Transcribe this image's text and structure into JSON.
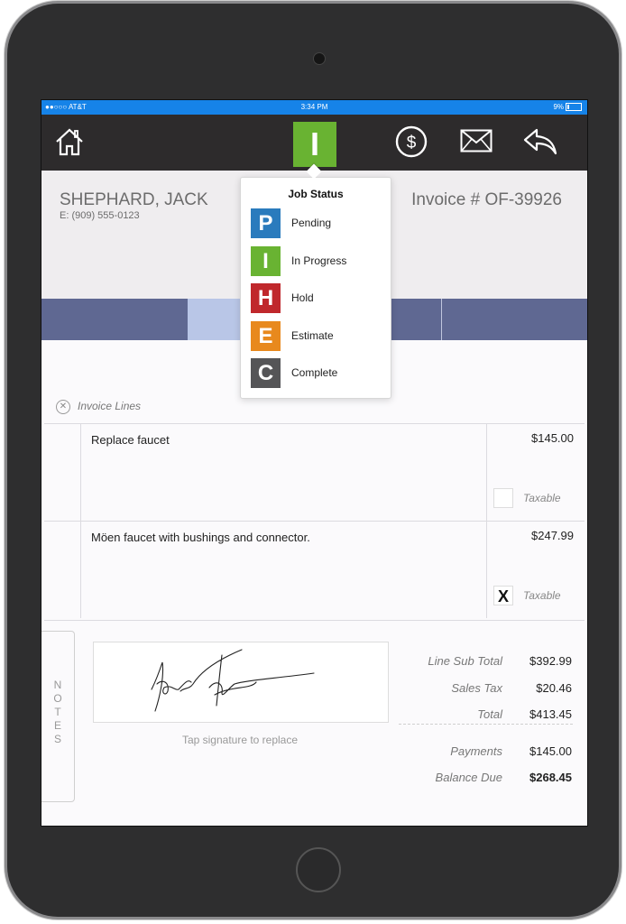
{
  "statusbar": {
    "carrier": "●●○○○ AT&T",
    "time": "3:34 PM",
    "battery": "9%"
  },
  "toolbar": {
    "home_icon": "home-icon",
    "job_status_letter": "I",
    "job_status_color": "#69b332",
    "payment_icon": "dollar-circle-icon",
    "email_icon": "envelope-icon",
    "back_icon": "reply-arrow-icon"
  },
  "customer": {
    "name": "SHEPHARD, JACK",
    "phone": "E: (909) 555-0123"
  },
  "invoice": {
    "number": "Invoice # OF-39926"
  },
  "job_status_menu": {
    "title": "Job Status",
    "items": [
      {
        "letter": "P",
        "label": "Pending",
        "color": "#2a7bbd"
      },
      {
        "letter": "I",
        "label": "In Progress",
        "color": "#69b332"
      },
      {
        "letter": "H",
        "label": "Hold",
        "color": "#c0282c"
      },
      {
        "letter": "E",
        "label": "Estimate",
        "color": "#e8891d"
      },
      {
        "letter": "C",
        "label": "Complete",
        "color": "#555557"
      }
    ]
  },
  "invoice_lines": {
    "header": "Invoice Lines",
    "lines": [
      {
        "description": "Replace faucet",
        "amount": "$145.00",
        "taxable_label": "Taxable",
        "taxable_mark": ""
      },
      {
        "description": "Möen faucet with bushings and connector.",
        "amount": "$247.99",
        "taxable_label": "Taxable",
        "taxable_mark": "X"
      }
    ]
  },
  "notes_label": "NOTES",
  "signature": {
    "caption": "Tap signature to replace"
  },
  "totals": {
    "line_sub_total_label": "Line Sub Total",
    "line_sub_total": "$392.99",
    "sales_tax_label": "Sales Tax",
    "sales_tax": "$20.46",
    "total_label": "Total",
    "total": "$413.45",
    "payments_label": "Payments",
    "payments": "$145.00",
    "balance_due_label": "Balance Due",
    "balance_due": "$268.45"
  }
}
